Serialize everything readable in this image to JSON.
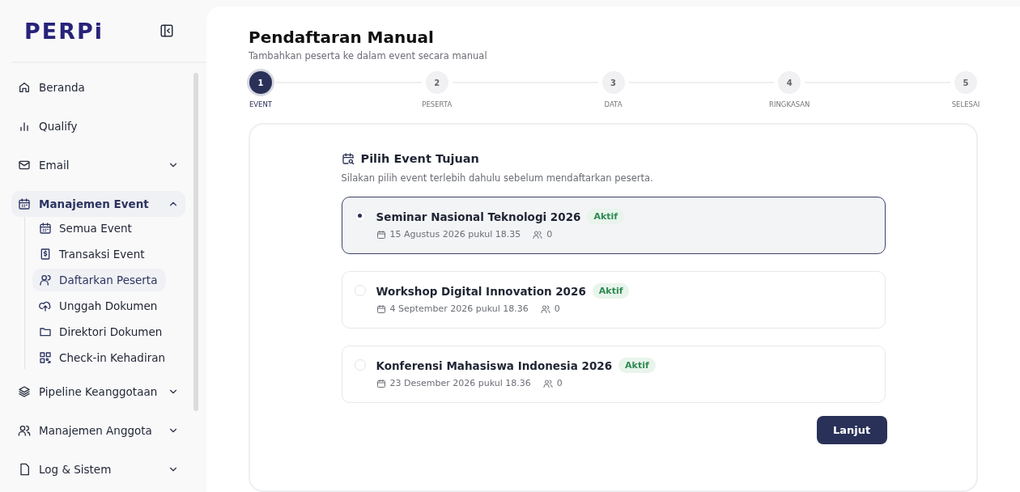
{
  "brand": {
    "logo": "PERPi"
  },
  "sidebar": {
    "items": [
      {
        "kind": "item",
        "label": "Beranda"
      },
      {
        "kind": "item",
        "label": "Qualify"
      },
      {
        "kind": "group",
        "label": "Email",
        "expanded": false,
        "selected": false
      },
      {
        "kind": "group",
        "label": "Manajemen Event",
        "expanded": true,
        "selected": true,
        "children": [
          {
            "label": "Semua Event",
            "selected": false
          },
          {
            "label": "Transaksi Event",
            "selected": false
          },
          {
            "label": "Daftarkan Peserta",
            "selected": true
          },
          {
            "label": "Unggah Dokumen",
            "selected": false
          },
          {
            "label": "Direktori Dokumen",
            "selected": false
          },
          {
            "label": "Check-in Kehadiran",
            "selected": false
          }
        ]
      },
      {
        "kind": "group",
        "label": "Pipeline Keanggotaan",
        "expanded": false,
        "selected": false
      },
      {
        "kind": "group",
        "label": "Manajemen Anggota",
        "expanded": false,
        "selected": false
      },
      {
        "kind": "group",
        "label": "Log & Sistem",
        "expanded": false,
        "selected": false
      }
    ]
  },
  "page": {
    "title": "Pendaftaran Manual",
    "subtitle": "Tambahkan peserta ke dalam event secara manual"
  },
  "steps": [
    {
      "number": "1",
      "label": "EVENT",
      "selected": true
    },
    {
      "number": "2",
      "label": "PESERTA",
      "selected": false
    },
    {
      "number": "3",
      "label": "DATA",
      "selected": false
    },
    {
      "number": "4",
      "label": "RINGKASAN",
      "selected": false
    },
    {
      "number": "5",
      "label": "SELESAI",
      "selected": false
    }
  ],
  "panel": {
    "title": "Pilih Event Tujuan",
    "hint": "Silakan pilih event terlebih dahulu sebelum mendaftarkan peserta.",
    "events": [
      {
        "name": "Seminar Nasional Teknologi 2026",
        "status": "Aktif",
        "date": "15 Agustus 2026 pukul 18.35",
        "participants": "0",
        "selected": true
      },
      {
        "name": "Workshop Digital Innovation 2026",
        "status": "Aktif",
        "date": "4 September 2026 pukul 18.36",
        "participants": "0",
        "selected": false
      },
      {
        "name": "Konferensi Mahasiswa Indonesia 2026",
        "status": "Aktif",
        "date": "23 Desember 2026 pukul 18.36",
        "participants": "0",
        "selected": false
      }
    ],
    "next_button": "Lanjut"
  }
}
